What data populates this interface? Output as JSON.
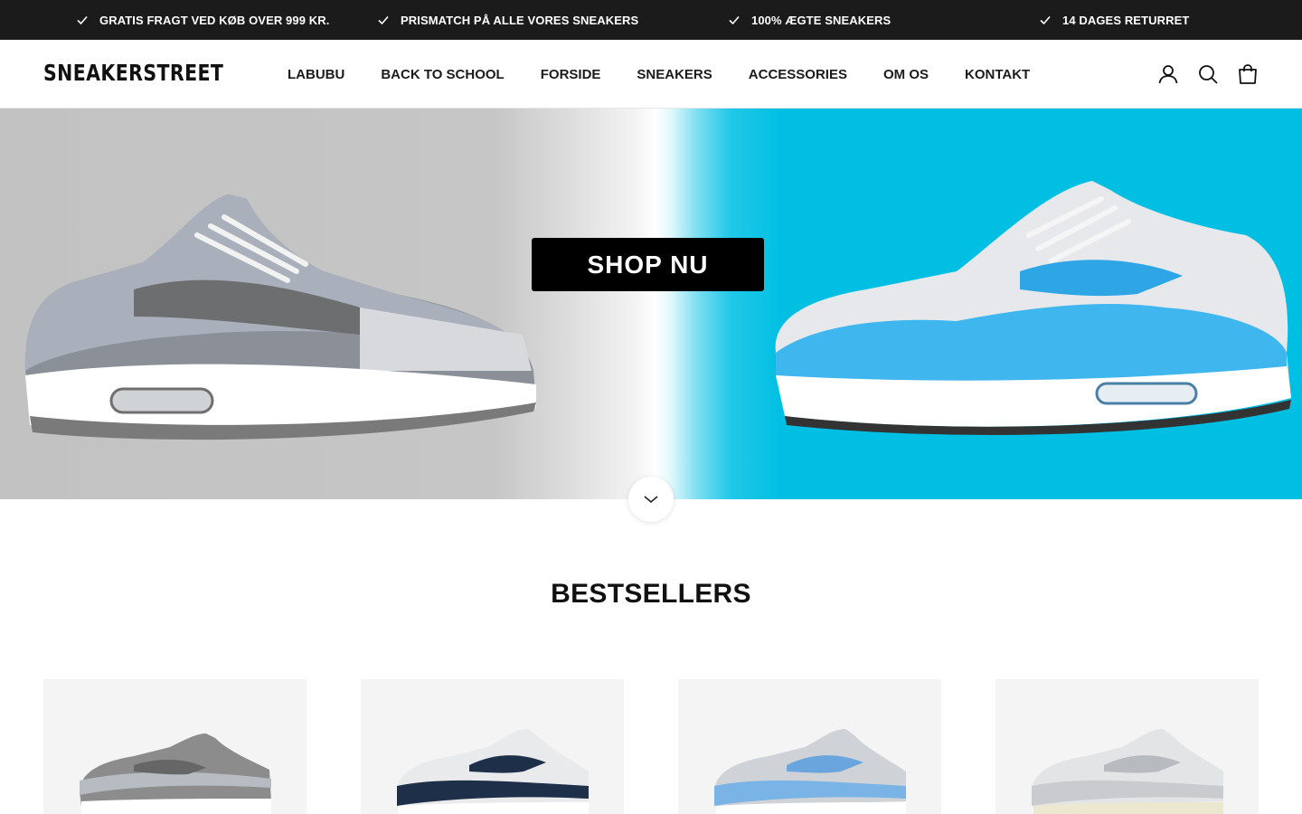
{
  "announcements": [
    {
      "text": "GRATIS FRAGT VED KØB OVER 999 KR."
    },
    {
      "text": "PRISMATCH PÅ ALLE VORES SNEAKERS"
    },
    {
      "text": "100% ÆGTE SNEAKERS"
    },
    {
      "text": "14 DAGES RETURRET"
    }
  ],
  "header": {
    "logo": "SNEAKERSTREET",
    "nav": [
      "LABUBU",
      "BACK TO SCHOOL",
      "FORSIDE",
      "SNEAKERS",
      "ACCESSORIES",
      "OM OS",
      "KONTAKT"
    ],
    "icons": [
      "account-icon",
      "search-icon",
      "cart-bag-icon"
    ]
  },
  "hero": {
    "cta_label": "SHOP NU",
    "left_shoe": "grey sneaker",
    "right_shoe": "blue sneaker"
  },
  "bestsellers": {
    "title": "BESTSELLERS",
    "products": [
      {
        "colorway": "grey"
      },
      {
        "colorway": "navy"
      },
      {
        "colorway": "light-blue"
      },
      {
        "colorway": "white-grey"
      }
    ]
  },
  "colors": {
    "announce_bg": "#1b1b1b",
    "hero_left": "#c4c4c4",
    "hero_right": "#00bfe3",
    "cta_bg": "#000000"
  }
}
